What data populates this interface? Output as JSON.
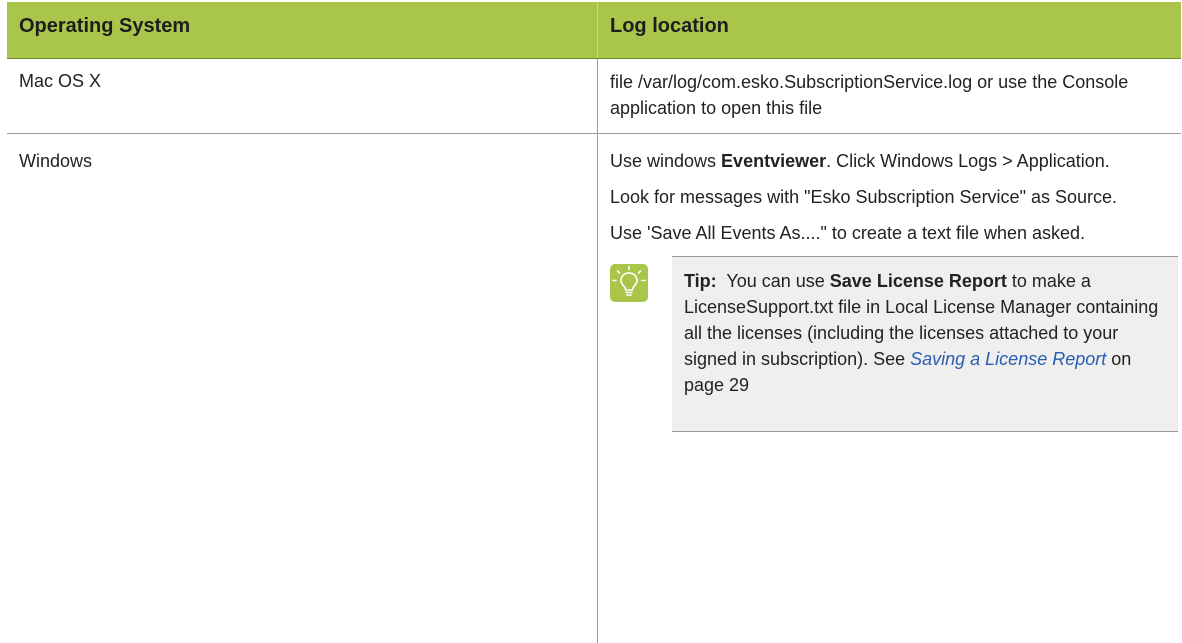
{
  "header": {
    "col1": "Operating System",
    "col2": "Log location"
  },
  "rows": [
    {
      "os": "Mac OS X",
      "location": "file /var/log/com.esko.SubscriptionService.log or use the Console application to open this file"
    },
    {
      "os": "Windows",
      "p1_pre": "Use windows ",
      "p1_bold": "Eventviewer",
      "p1_post": ". Click Windows Logs > Application.",
      "p2": "Look for messages with \"Esko Subscription Service\" as Source.",
      "p3": "Use 'Save All Events As....\" to create a text file when asked."
    }
  ],
  "tip": {
    "icon": "lightbulb-icon",
    "label": "Tip:",
    "text_pre": "  You can use ",
    "text_bold": "Save License Report",
    "text_mid": " to make a LicenseSupport.txt file in Local License Manager containing all the licenses (including the licenses attached to your signed in subscription). See ",
    "link_text": "Saving a License Report",
    "text_post": " on page 29"
  },
  "colors": {
    "header_bg": "#a9c64a",
    "tip_bg": "#efefef",
    "link": "#2a5db0"
  }
}
